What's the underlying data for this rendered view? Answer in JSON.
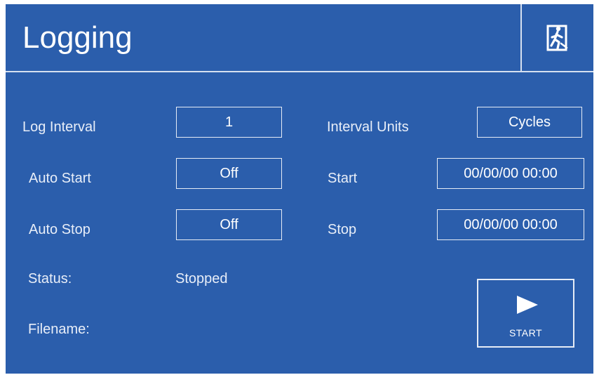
{
  "header": {
    "title": "Logging",
    "exit_icon": "exit-running-man-icon"
  },
  "form": {
    "log_interval": {
      "label": "Log Interval",
      "value": "1"
    },
    "interval_units": {
      "label": "Interval Units",
      "value": "Cycles"
    },
    "auto_start": {
      "label": "Auto Start",
      "value": "Off"
    },
    "start": {
      "label": "Start",
      "value": "00/00/00 00:00"
    },
    "auto_stop": {
      "label": "Auto Stop",
      "value": "Off"
    },
    "stop": {
      "label": "Stop",
      "value": "00/00/00 00:00"
    },
    "status": {
      "label": "Status:",
      "value": "Stopped"
    },
    "filename": {
      "label": "Filename:",
      "value": ""
    }
  },
  "start_button": {
    "label": "START",
    "icon": "play-icon"
  },
  "colors": {
    "background": "#2b5eac",
    "text": "#ffffff",
    "border": "#e6ecf6"
  }
}
